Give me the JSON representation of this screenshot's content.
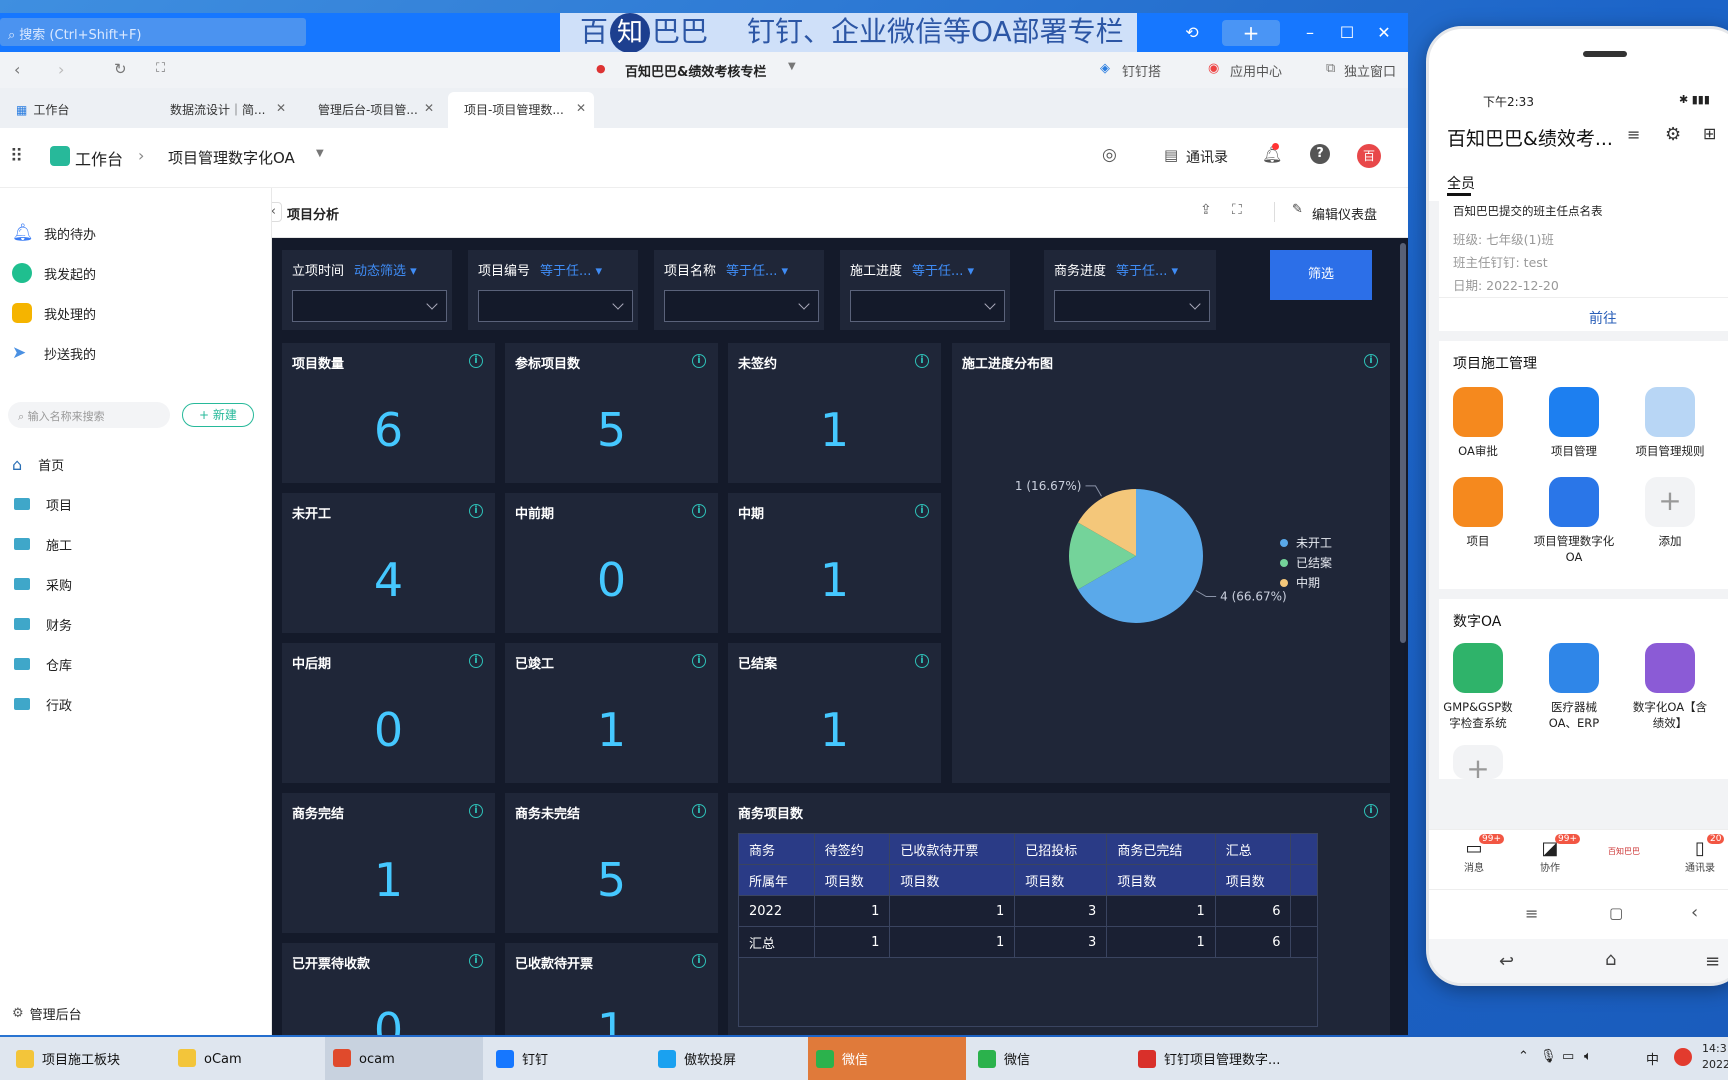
{
  "window": {
    "search_placeholder": "搜索 (Ctrl+Shift+F)",
    "banner": {
      "brand_a": "百",
      "brand_b": "知",
      "brand_c": "巴巴",
      "text": "钉钉、企业微信等OA部署专栏"
    },
    "org_title": "百知巴巴&绩效考核专栏",
    "links": [
      "钉钉搭",
      "应用中心",
      "独立窗口"
    ],
    "tabs": [
      {
        "label": "工作台",
        "active": false
      },
      {
        "label": "数据流设计｜简...",
        "active": false
      },
      {
        "label": "管理后台-项目管...",
        "active": false
      },
      {
        "label": "项目-项目管理数...",
        "active": true
      }
    ]
  },
  "app": {
    "workbench": "工作台",
    "app_name": "项目管理数字化OA",
    "contacts": "通讯录",
    "avatar": "百"
  },
  "sidebar": {
    "top_items": [
      {
        "label": "我的待办",
        "color": "#3a7cf5"
      },
      {
        "label": "我发起的",
        "color": "#1fbf8f"
      },
      {
        "label": "我处理的",
        "color": "#f5b400"
      },
      {
        "label": "抄送我的",
        "color": "#4a90e2"
      }
    ],
    "search_placeholder": "输入名称来搜索",
    "new_button": "新建",
    "home": "首页",
    "folders": [
      "项目",
      "施工",
      "采购",
      "财务",
      "仓库",
      "行政"
    ],
    "admin": "管理后台"
  },
  "dashboard": {
    "title": "项目分析",
    "edit": "编辑仪表盘",
    "filter_button": "筛选",
    "filters": [
      {
        "label": "立项时间",
        "op": "动态筛选"
      },
      {
        "label": "项目编号",
        "op": "等于任..."
      },
      {
        "label": "项目名称",
        "op": "等于任..."
      },
      {
        "label": "施工进度",
        "op": "等于任..."
      },
      {
        "label": "商务进度",
        "op": "等于任..."
      }
    ],
    "cards": [
      {
        "title": "项目数量",
        "value": "6"
      },
      {
        "title": "参标项目数",
        "value": "5"
      },
      {
        "title": "未签约",
        "value": "1"
      },
      {
        "title": "未开工",
        "value": "4"
      },
      {
        "title": "中前期",
        "value": "0"
      },
      {
        "title": "中期",
        "value": "1"
      },
      {
        "title": "中后期",
        "value": "0"
      },
      {
        "title": "已竣工",
        "value": "1"
      },
      {
        "title": "已结案",
        "value": "1"
      },
      {
        "title": "商务完结",
        "value": "1"
      },
      {
        "title": "商务未完结",
        "value": "5"
      },
      {
        "title": "已开票待收款",
        "value": "0"
      },
      {
        "title": "已收款待开票",
        "value": "1"
      }
    ],
    "pie_title": "施工进度分布图",
    "table_title": "商务项目数",
    "table": {
      "header1": [
        "商务",
        "待签约",
        "已收款待开票",
        "已招投标",
        "商务已完结",
        "汇总"
      ],
      "header2": [
        "所属年",
        "项目数",
        "项目数",
        "项目数",
        "项目数",
        "项目数"
      ],
      "rows": [
        [
          "2022",
          "1",
          "1",
          "3",
          "1",
          "6"
        ],
        [
          "汇总",
          "1",
          "1",
          "3",
          "1",
          "6"
        ]
      ]
    }
  },
  "chart_data": {
    "type": "pie",
    "title": "施工进度分布图",
    "categories": [
      "未开工",
      "已结案",
      "中期"
    ],
    "values": [
      4,
      1,
      1
    ],
    "labels": [
      "4 (66.67%)",
      "",
      "1 (16.67%)"
    ],
    "colors": [
      "#5aa9ea",
      "#74d39a",
      "#f4c77a"
    ],
    "legend": "right"
  },
  "phone": {
    "time": "下午2:33",
    "org": "百知巴巴&绩效考...",
    "tab": "全员",
    "notice_title": "百知巴巴提交的班主任点名表",
    "notice_lines": [
      "班级: 七年级(1)班",
      "班主任钉钉: test",
      "日期: 2022-12-20"
    ],
    "goto": "前往",
    "sec1": "项目施工管理",
    "apps1": [
      {
        "label": "OA审批",
        "color": "#f5891e"
      },
      {
        "label": "项目管理",
        "color": "#1d7ff0"
      },
      {
        "label": "项目管理规则",
        "color": "#b8d6f5"
      },
      {
        "label": "项目",
        "color": "#f5891e"
      },
      {
        "label": "项目管理数字化OA",
        "color": "#2a76e8"
      },
      {
        "label": "添加",
        "color": "#f2f3f5"
      }
    ],
    "sec2": "数字OA",
    "apps2": [
      {
        "label": "GMP&GSP数字检查系统",
        "color": "#2fb36a"
      },
      {
        "label": "医疗器械OA、ERP",
        "color": "#2f86e8"
      },
      {
        "label": "数字化OA【含绩效】",
        "color": "#8b5bd6"
      }
    ],
    "nav": [
      {
        "label": "消息",
        "badge": "99+"
      },
      {
        "label": "协作",
        "badge": "99+"
      },
      {
        "label": "百知巴巴",
        "badge": ""
      },
      {
        "label": "通讯录",
        "badge": "20"
      }
    ]
  },
  "taskbar": {
    "items": [
      {
        "label": "项目施工板块",
        "color": "#f3c53a"
      },
      {
        "label": "oCam",
        "color": "#f3c53a"
      },
      {
        "label": "ocam",
        "color": "#e04a2c"
      },
      {
        "label": "钉钉",
        "color": "#1677ff"
      },
      {
        "label": "傲软投屏",
        "color": "#1aa1f0"
      },
      {
        "label": "微信",
        "color": "#2bb24c"
      },
      {
        "label": "微信",
        "color": "#2bb24c"
      },
      {
        "label": "钉钉项目管理数字...",
        "color": "#d9302a"
      }
    ],
    "tray_ime": "中",
    "clock": "14:3\n2022"
  }
}
